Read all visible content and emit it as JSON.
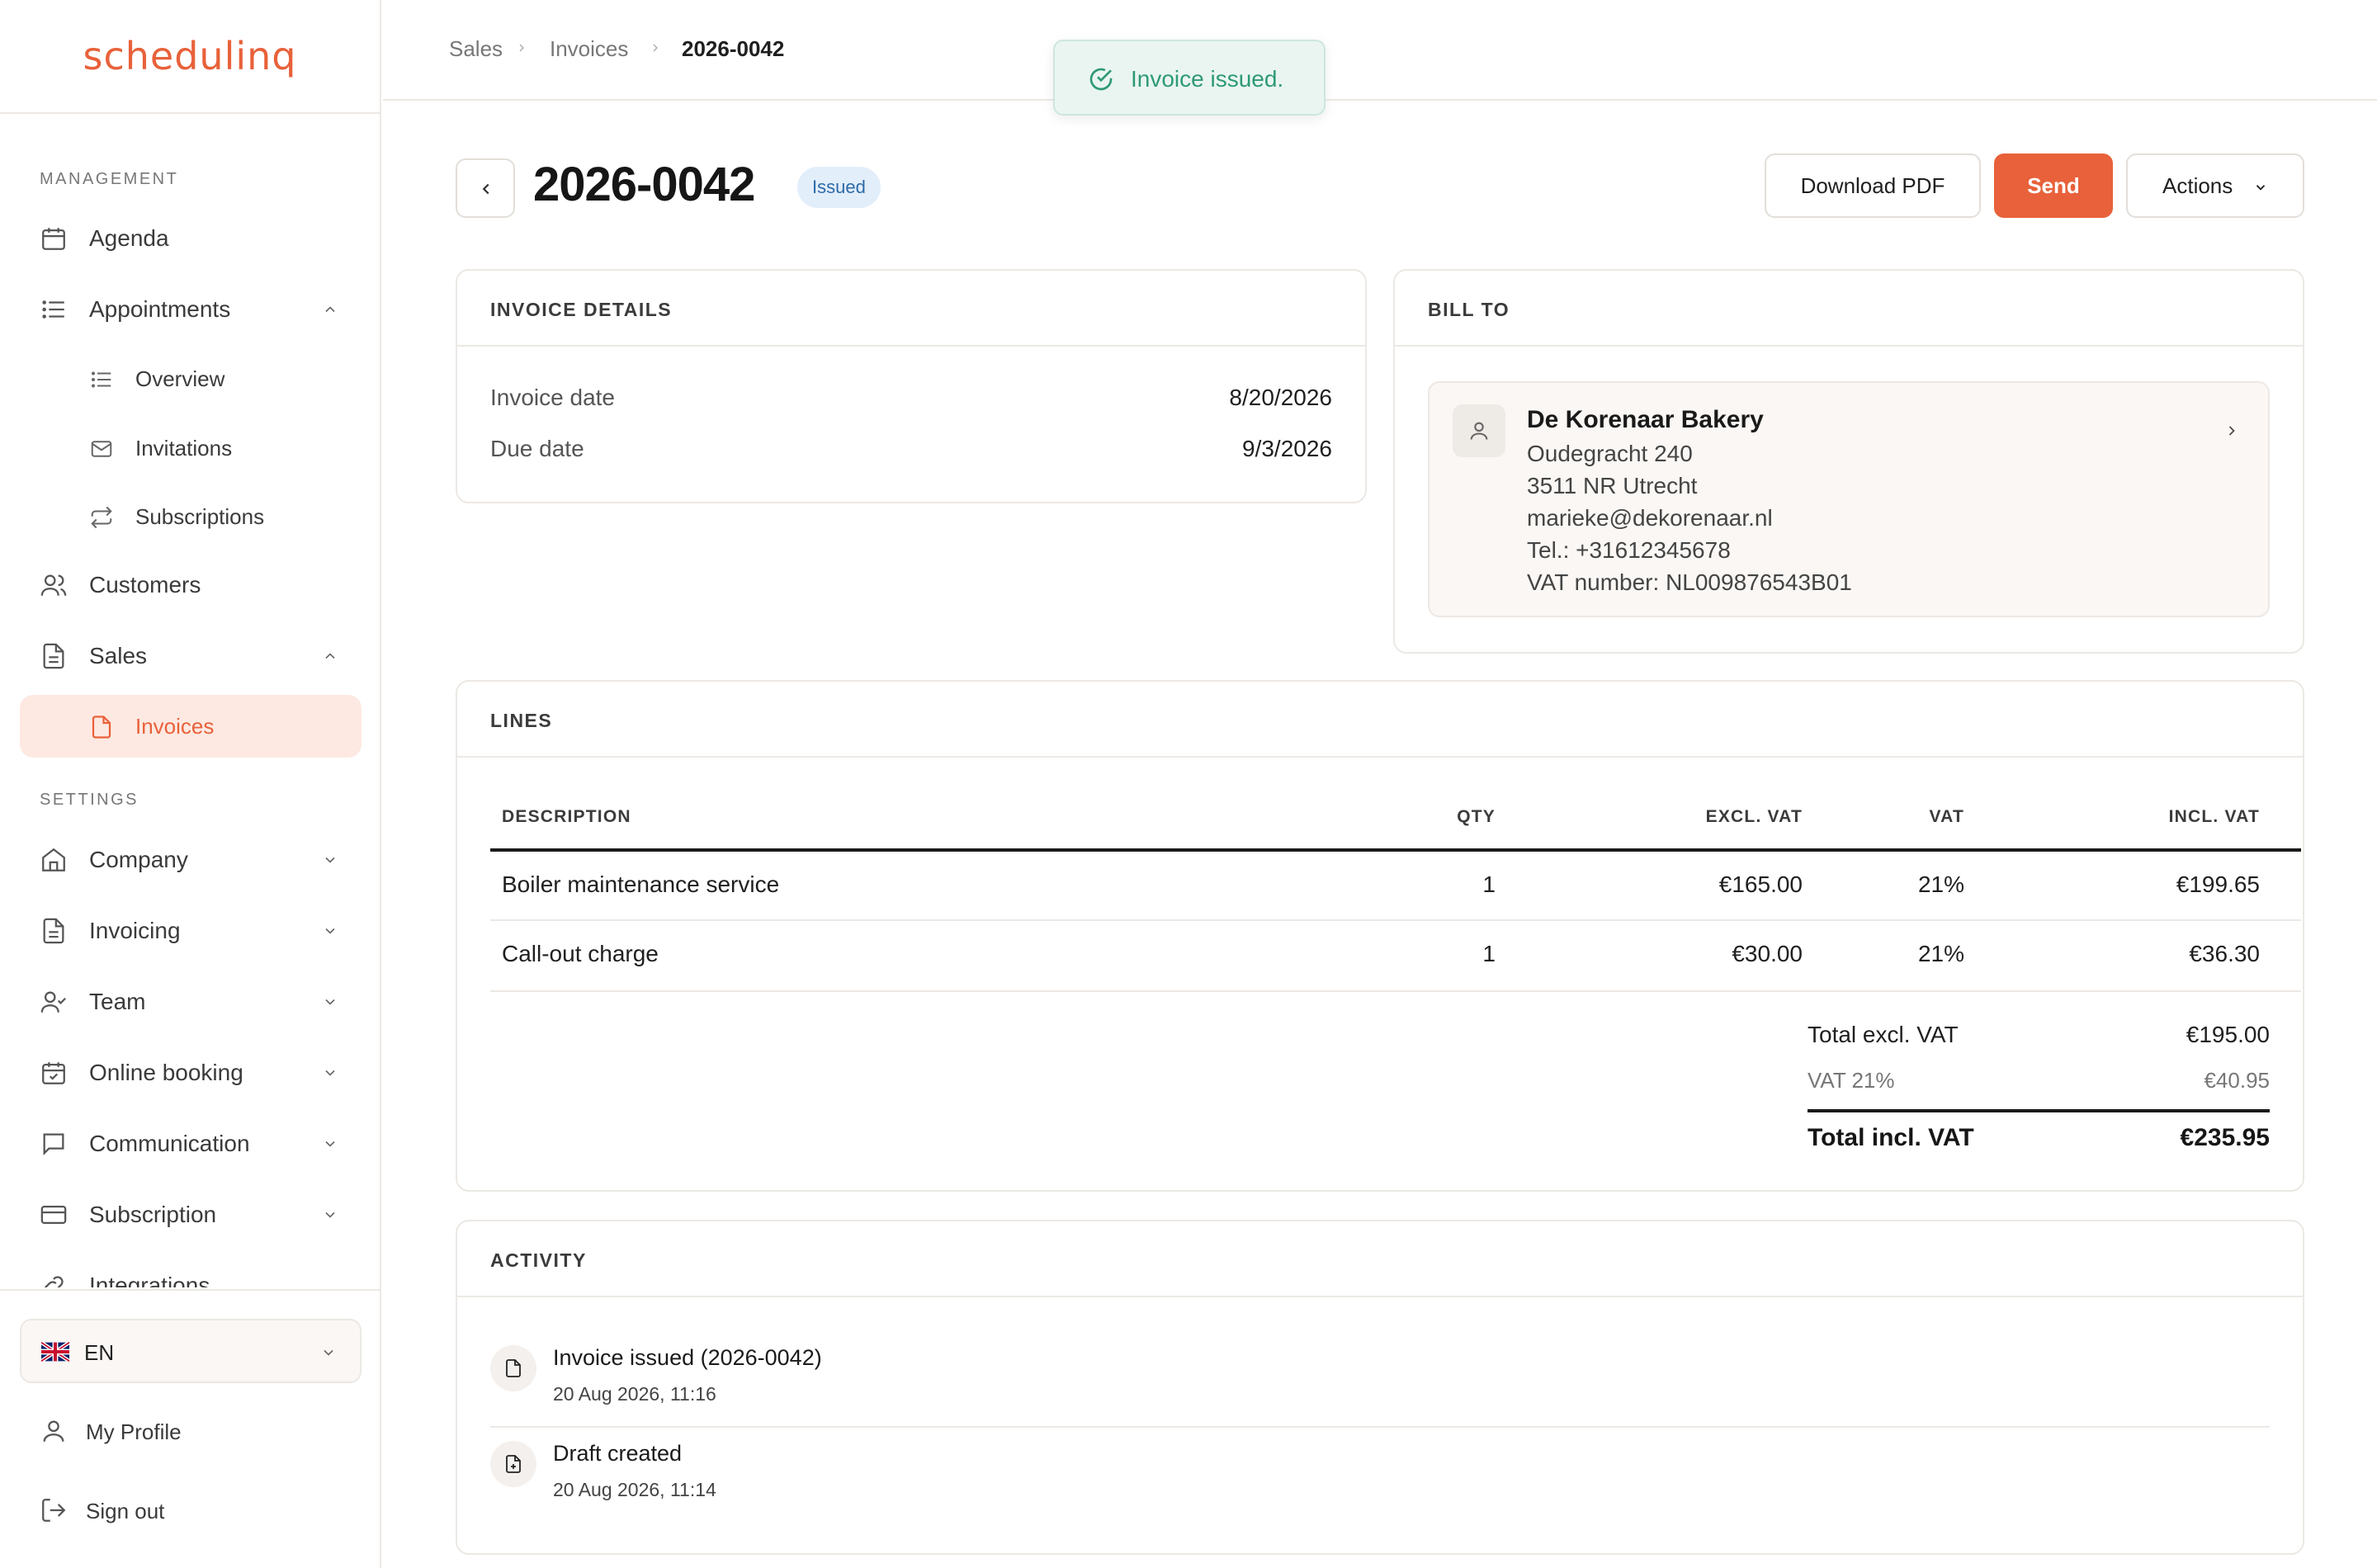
{
  "brand": {
    "logo_text": "schedulinq",
    "accent_color": "#e8613a"
  },
  "sidebar": {
    "management_label": "MANAGEMENT",
    "settings_label": "SETTINGS",
    "items": {
      "agenda": "Agenda",
      "appointments": "Appointments",
      "overview": "Overview",
      "invitations": "Invitations",
      "subscriptions": "Subscriptions",
      "customers": "Customers",
      "sales": "Sales",
      "invoices": "Invoices",
      "company": "Company",
      "invoicing": "Invoicing",
      "team": "Team",
      "online_booking": "Online booking",
      "communication": "Communication",
      "subscription": "Subscription",
      "integrations": "Integrations"
    },
    "language": "EN",
    "my_profile": "My Profile",
    "sign_out": "Sign out"
  },
  "breadcrumb": {
    "level1": "Sales",
    "level2": "Invoices",
    "current": "2026-0042"
  },
  "toast": {
    "message": "Invoice issued.",
    "color": "#2e9a74"
  },
  "header": {
    "title": "2026-0042",
    "status": "Issued",
    "download_label": "Download PDF",
    "send_label": "Send",
    "actions_label": "Actions"
  },
  "invoice_details": {
    "title": "INVOICE DETAILS",
    "invoice_date_label": "Invoice date",
    "invoice_date": "8/20/2026",
    "due_date_label": "Due date",
    "due_date": "9/3/2026"
  },
  "bill_to": {
    "title": "BILL TO",
    "name": "De Korenaar Bakery",
    "street": "Oudegracht 240",
    "city": "3511 NR Utrecht",
    "email": "marieke@dekorenaar.nl",
    "phone": "Tel.: +31612345678",
    "vat": "VAT number: NL009876543B01"
  },
  "lines": {
    "title": "LINES",
    "columns": {
      "description": "DESCRIPTION",
      "qty": "QTY",
      "excl": "EXCL. VAT",
      "vat": "VAT",
      "incl": "INCL. VAT"
    },
    "rows": [
      {
        "description": "Boiler maintenance service",
        "qty": "1",
        "excl": "€165.00",
        "vat": "21%",
        "incl": "€199.65"
      },
      {
        "description": "Call-out charge",
        "qty": "1",
        "excl": "€30.00",
        "vat": "21%",
        "incl": "€36.30"
      }
    ],
    "totals": {
      "excl_label": "Total excl. VAT",
      "excl_value": "€195.00",
      "vat_label": "VAT 21%",
      "vat_value": "€40.95",
      "incl_label": "Total incl. VAT",
      "incl_value": "€235.95"
    }
  },
  "activity": {
    "title": "ACTIVITY",
    "items": [
      {
        "title": "Invoice issued (2026-0042)",
        "time": "20 Aug 2026, 11:16",
        "icon": "document-icon"
      },
      {
        "title": "Draft created",
        "time": "20 Aug 2026, 11:14",
        "icon": "document-plus-icon"
      }
    ]
  }
}
